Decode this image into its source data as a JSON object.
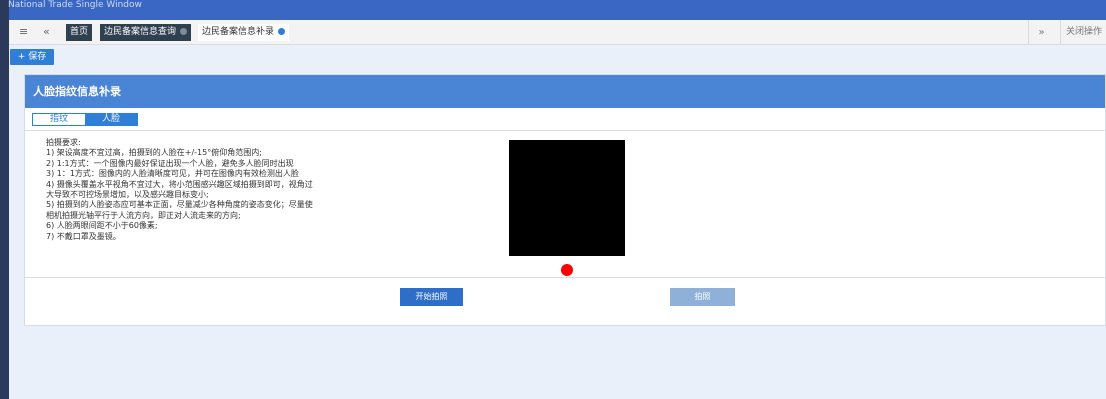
{
  "app": {
    "title": "National Trade Single Window"
  },
  "tabbar": {
    "menu_icon": "menu-icon",
    "back_icon": "double-chevron-left-icon",
    "tabs": [
      {
        "label": "首页",
        "closable": false,
        "active": false
      },
      {
        "label": "边民备案信息查询",
        "closable": true,
        "active": false
      },
      {
        "label": "边民备案信息补录",
        "closable": true,
        "active": true
      }
    ],
    "forward_icon": "double-chevron-right-icon",
    "close_ops_label": "关闭操作"
  },
  "toolbar": {
    "save_label": "+ 保存"
  },
  "panel": {
    "title": "人脸指纹信息补录",
    "segments": [
      {
        "label": "指纹",
        "active": false
      },
      {
        "label": "人脸",
        "active": true
      }
    ],
    "requirements": [
      "拍摄要求:",
      "1) 架设高度不宜过高，拍摄到的人脸在+/-15°俯仰角范围内;",
      "2) 1:1方式：一个图像内最好保证出现一个人脸，避免多人脸同时出现",
      "3) 1：1方式：图像内的人脸清晰度可见，并可在图像内有效检测出人脸",
      "4) 摄像头覆盖水平视角不宜过大，将小范围感兴趣区域拍摄到即可，视角过",
      "大导致不可控场景增加，以及感兴趣目标变小;",
      "5) 拍摄到的人脸姿态应可基本正面，尽量减少各种角度的姿态变化；尽量使",
      "相机拍摄光轴平行于人流方向，即正对人流走来的方向;",
      "6) 人脸两眼间距不小于60像素;",
      "7) 不戴口罩及墨镜。"
    ],
    "start_capture_label": "开始拍照",
    "capture_label": "拍照"
  },
  "colors": {
    "top_bar": "#3a67c4",
    "panel_header": "#4a84d4",
    "primary_button": "#2f6ec8",
    "disabled_button": "#8fb1d8",
    "record_dot": "#ff0000"
  }
}
